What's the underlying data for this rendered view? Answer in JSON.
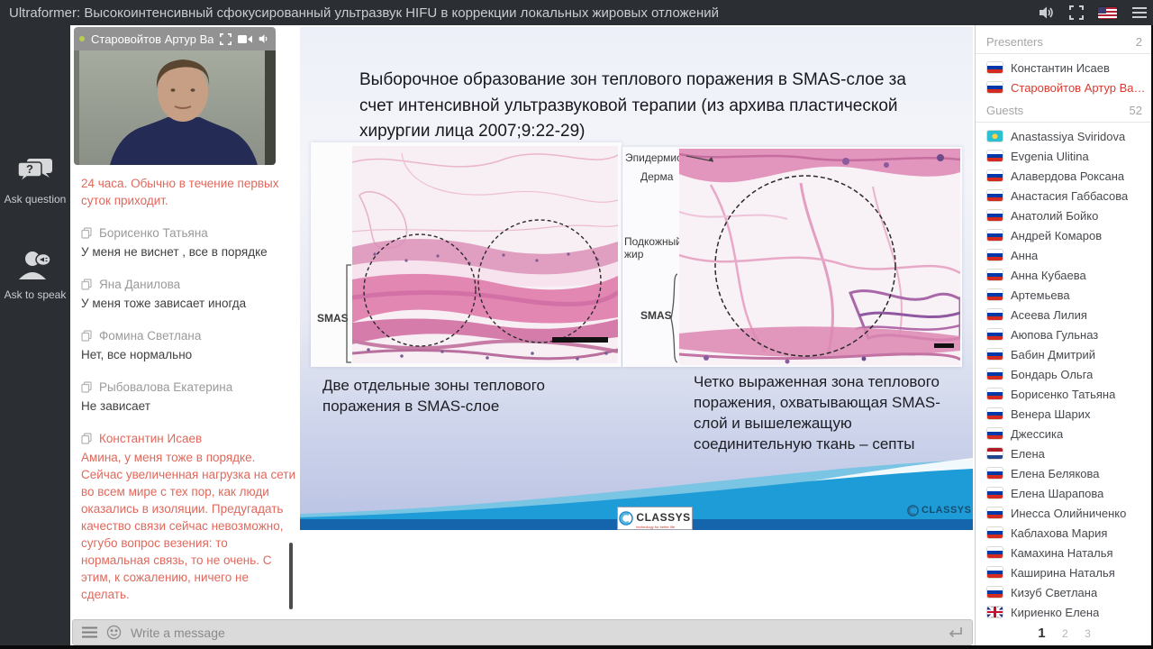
{
  "window": {
    "title": "Ultraformer: Высокоинтенсивный сфокусированный ультразвук HIFU в коррекции локальных жировых отложений",
    "icons": [
      "volume-icon",
      "fullscreen-icon",
      "us-flag",
      "menu-icon"
    ]
  },
  "sidebar": {
    "ask_question": "Ask question",
    "ask_to_speak": "Ask to speak",
    "icons": [
      "question-bubbles-icon",
      "speaker-person-icon"
    ]
  },
  "video": {
    "presenter_name": "Старовойтов Артур Ва...",
    "icons": [
      "fullscreen-icon",
      "camera-icon",
      "volume-icon"
    ]
  },
  "chat": {
    "messages": [
      {
        "author": "",
        "text": "24 часа. Обычно в течение первых суток приходит.",
        "highlight": true
      },
      {
        "author": "Борисенко Татьяна",
        "text": "У меня не виснет , все в порядке",
        "highlight": false
      },
      {
        "author": "Яна Данилова",
        "text": "У меня тоже зависает иногда",
        "highlight": false
      },
      {
        "author": "Фомина Светлана",
        "text": "Нет, все нормально",
        "highlight": false
      },
      {
        "author": "Рыбовалова Екатерина",
        "text": "Не зависает",
        "highlight": false
      },
      {
        "author": "Константин Исаев",
        "text": "Амина, у меня тоже в порядке. Сейчас увеличенная нагрузка на сети во всем мире с тех пор, как люди оказались в изоляции. Предугадать качество связи сейчас невозможно, сугубо вопрос везения: то нормальная связь, то не очень. С этим, к сожалению, ничего не сделать.",
        "highlight": true
      }
    ],
    "input_placeholder": "Write a message"
  },
  "slide": {
    "title": "Выборочное образование зон теплового поражения в SMAS-слое за счет интенсивной ультразвуковой терапии (из архива пластической хирургии лица 2007;9:22-29)",
    "left_image": {
      "labels": [
        "SMAS"
      ],
      "caption": "Две отдельные зоны теплового поражения в SMAS-слое"
    },
    "right_image": {
      "labels": [
        "Эпидермис",
        "Дерма",
        "Подкожный жир",
        "SMAS"
      ],
      "caption": "Четко выраженная зона теплового поражения, охватывающая SMAS-слой и вышележащую соединительную ткань – септы"
    },
    "logo": "CLASSYS",
    "logo_tagline": "technology for better life"
  },
  "participants": {
    "presenters_label": "Presenters",
    "presenters_count": "2",
    "presenters": [
      {
        "name": "Константин Исаев",
        "country": "ru",
        "highlight": false
      },
      {
        "name": "Старовойтов Артур Василье...",
        "country": "ru",
        "highlight": true
      }
    ],
    "guests_label": "Guests",
    "guests_count": "52",
    "guests": [
      {
        "name": "Anastassiya Sviridova",
        "country": "kz"
      },
      {
        "name": "Evgenia Ulitina",
        "country": "ru"
      },
      {
        "name": "Алавердова Роксана",
        "country": "ru"
      },
      {
        "name": "Анастасия Габбасова",
        "country": "ru"
      },
      {
        "name": "Анатолий Бойко",
        "country": "ru"
      },
      {
        "name": "Андрей Комаров",
        "country": "ru"
      },
      {
        "name": "Анна",
        "country": "ru"
      },
      {
        "name": "Анна Кубаева",
        "country": "ru"
      },
      {
        "name": "Артемьева",
        "country": "ru"
      },
      {
        "name": "Асеева Лилия",
        "country": "ru"
      },
      {
        "name": "Аюпова Гульназ",
        "country": "ru"
      },
      {
        "name": "Бабин Дмитрий",
        "country": "ru"
      },
      {
        "name": "Бондарь Ольга",
        "country": "ru"
      },
      {
        "name": "Борисенко Татьяна",
        "country": "ru"
      },
      {
        "name": "Венера Шарих",
        "country": "ru"
      },
      {
        "name": "Джессика",
        "country": "ru"
      },
      {
        "name": "Елена",
        "country": "nl"
      },
      {
        "name": "Елена Белякова",
        "country": "ru"
      },
      {
        "name": "Елена Шарапова",
        "country": "ru"
      },
      {
        "name": "Инесса Олийниченко",
        "country": "ru"
      },
      {
        "name": "Каблахова Мария",
        "country": "ru"
      },
      {
        "name": "Камахина Наталья",
        "country": "ru"
      },
      {
        "name": "Каширина Наталья",
        "country": "ru"
      },
      {
        "name": "Кизуб Светлана",
        "country": "ru"
      },
      {
        "name": "Кириенко Елена",
        "country": "gb"
      }
    ],
    "pagination": [
      {
        "label": "1",
        "active": true
      },
      {
        "label": "2",
        "active": false
      },
      {
        "label": "3",
        "active": false
      }
    ]
  },
  "colors": {
    "topbar_bg": "#2b2e33",
    "chat_highlight": "#e0685c",
    "presenter_highlight": "#d93b30",
    "slide_wave_blue": "#1e9cd7",
    "slide_wave_dark": "#1565ad",
    "slide_bg_bottom": "#b9c2e4"
  }
}
